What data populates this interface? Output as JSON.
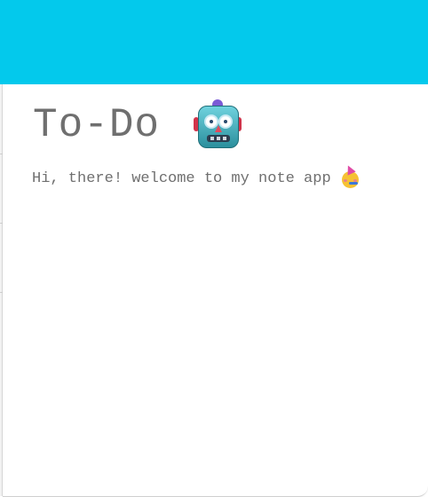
{
  "header": {
    "accent_color": "#03c9ec"
  },
  "main": {
    "title": "To-Do",
    "title_icon": "robot-icon",
    "greeting": "Hi, there! welcome to my note app",
    "greeting_icon": "party-face-icon"
  }
}
